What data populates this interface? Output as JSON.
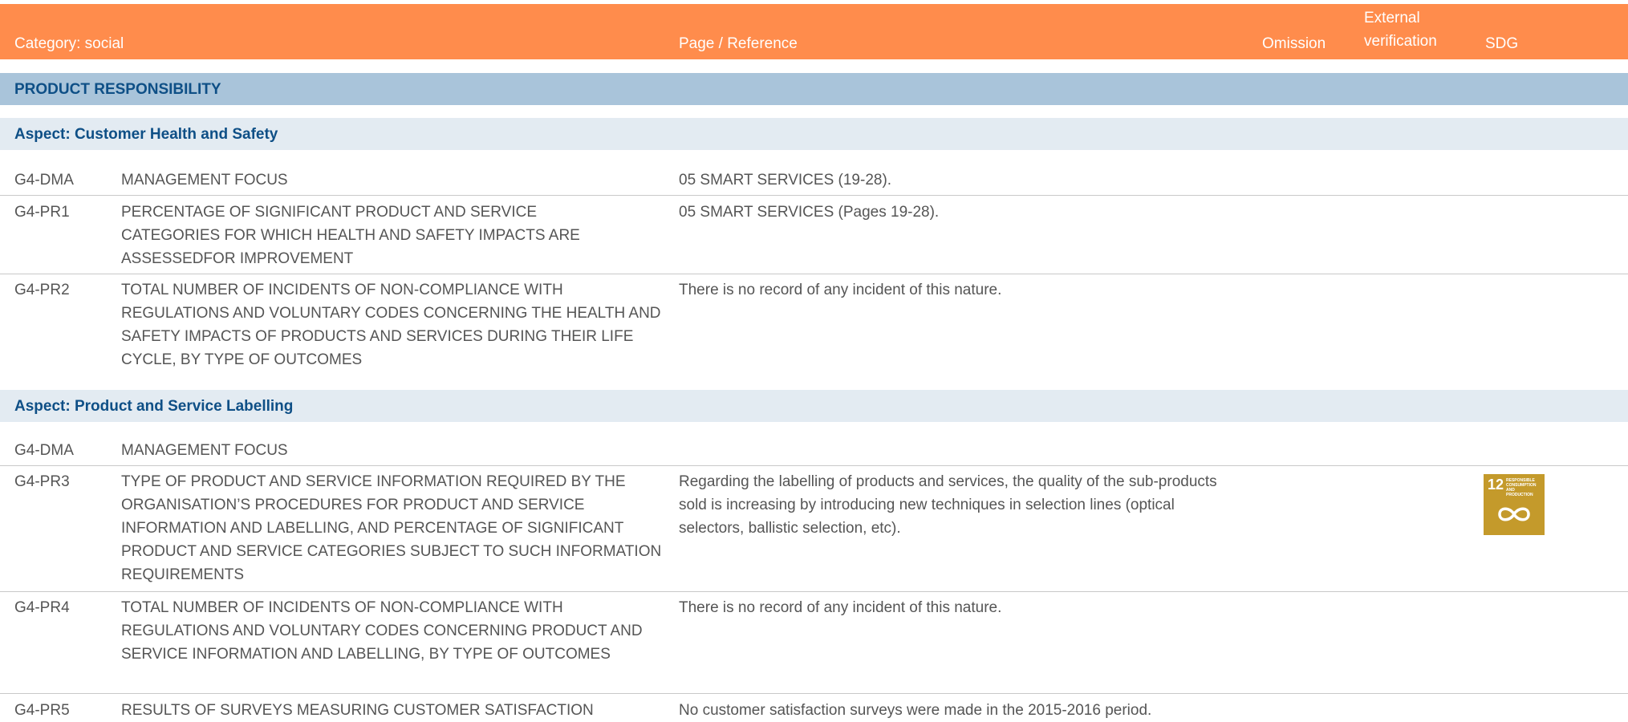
{
  "header": {
    "category": "Category: social",
    "page_reference": "Page / Reference",
    "omission": "Omission",
    "external_verification_line1": "External",
    "external_verification_line2": "verification",
    "sdg": "SDG"
  },
  "section": {
    "title": "PRODUCT RESPONSIBILITY"
  },
  "aspects": [
    {
      "title": "Aspect: Customer Health and Safety"
    },
    {
      "title": "Aspect: Product and Service Labelling"
    }
  ],
  "rows": [
    {
      "code": "G4-DMA",
      "description": "MANAGEMENT FOCUS",
      "reference": "05 SMART SERVICES (19-28)."
    },
    {
      "code": "G4-PR1",
      "description": "PERCENTAGE OF SIGNIFICANT PRODUCT AND SERVICE CATEGORIES FOR WHICH HEALTH AND SAFETY IMPACTS ARE ASSESSEDFOR IMPROVEMENT",
      "reference": "05 SMART SERVICES (Pages 19-28)."
    },
    {
      "code": "G4-PR2",
      "description": "TOTAL NUMBER OF INCIDENTS OF NON-COMPLIANCE WITH REGULATIONS AND VOLUNTARY CODES CONCERNING THE HEALTH AND SAFETY IMPACTS OF PRODUCTS AND SERVICES DURING THEIR LIFE CYCLE, BY TYPE OF OUTCOMES",
      "reference": "There is no record of any incident of this nature."
    },
    {
      "code": "G4-DMA",
      "description": "MANAGEMENT FOCUS",
      "reference": ""
    },
    {
      "code": "G4-PR3",
      "description": "TYPE OF PRODUCT AND SERVICE INFORMATION REQUIRED BY THE ORGANISATION’S PROCEDURES FOR PRODUCT AND SERVICE INFORMATION AND LABELLING, AND PERCENTAGE OF SIGNIFICANT PRODUCT AND SERVICE CATEGORIES SUBJECT TO SUCH INFORMATION REQUIREMENTS",
      "reference": "Regarding the labelling of products and services, the quality of the sub-products sold is increasing by introducing new techniques in selection lines (optical selectors, ballistic selection, etc)."
    },
    {
      "code": "G4-PR4",
      "description": "TOTAL NUMBER OF INCIDENTS OF NON-COMPLIANCE WITH REGULATIONS AND VOLUNTARY CODES CONCERNING PRODUCT AND SERVICE INFORMATION AND LABELLING, BY TYPE OF OUTCOMES",
      "reference": "There is no record of any incident of this nature."
    },
    {
      "code": "G4-PR5",
      "description": "RESULTS OF SURVEYS MEASURING CUSTOMER SATISFACTION",
      "reference": "No customer satisfaction surveys were made in the 2015-2016 period."
    }
  ],
  "sdg_badge": {
    "number": "12",
    "line1": "RESPONSIBLE",
    "line2": "CONSUMPTION",
    "line3": "AND PRODUCTION",
    "icon": "infinity-icon",
    "color": "#c49a2b"
  },
  "colors": {
    "header": "#ff8c4c",
    "section": "#a9c4da",
    "aspect": "#e3ebf2",
    "heading_text": "#0e4f86"
  }
}
